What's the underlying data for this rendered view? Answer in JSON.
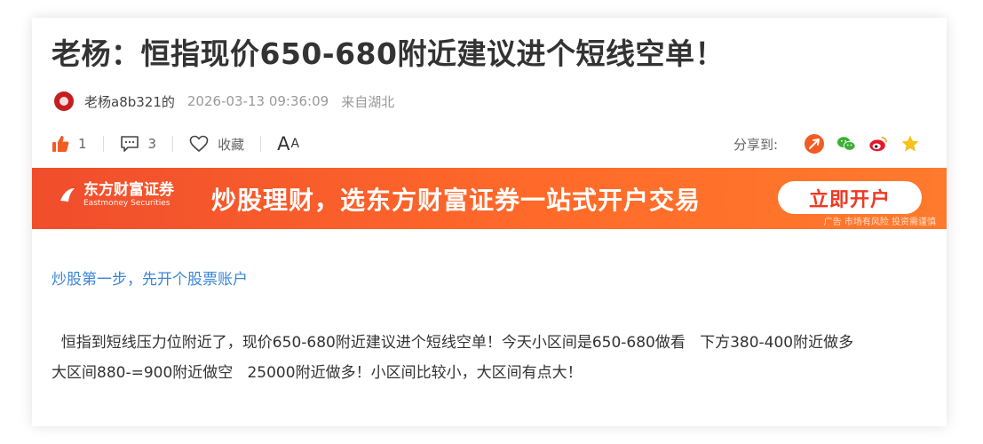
{
  "article": {
    "title": "老杨：恒指现价650-680附近建议进个短线空单！",
    "author": "老杨a8b321的",
    "time": "2026-03-13 09:36:09",
    "location": "来自湖北"
  },
  "actions": {
    "like_count": "1",
    "comment_count": "3",
    "favorite_label": "收藏",
    "font_big": "A",
    "font_small": "A",
    "share_label": "分享到:"
  },
  "banner": {
    "logo_cn": "东方财富证券",
    "logo_en": "Eastmoney Securities",
    "slogan": "炒股理财，选东方财富证券一站式开户交易",
    "button": "立即开户",
    "risk_note": "广告 市场有风险 投资需谨慎"
  },
  "promo_link": "炒股第一步，先开个股票账户",
  "content": {
    "line1": "  恒指到短线压力位附近了，现价650-680附近建议进个短线空单！今天小区间是650-680做看   下方380-400附近做多",
    "line2": "大区间880-=900附近做空   25000附近做多！小区间比较小，大区间有点大！"
  },
  "colors": {
    "like": "#f25c23",
    "link": "#3b85d8",
    "banner_start": "#f04d2c",
    "banner_end": "#ff7a2c",
    "wechat": "#3cb034",
    "weibo": "#e6162d",
    "qzone": "#f8c21c"
  },
  "icons": [
    "avatar",
    "thumbs-up-icon",
    "comment-icon",
    "heart-icon",
    "font-size-icon",
    "share-arrow-icon",
    "wechat-icon",
    "weibo-icon",
    "star-icon"
  ]
}
